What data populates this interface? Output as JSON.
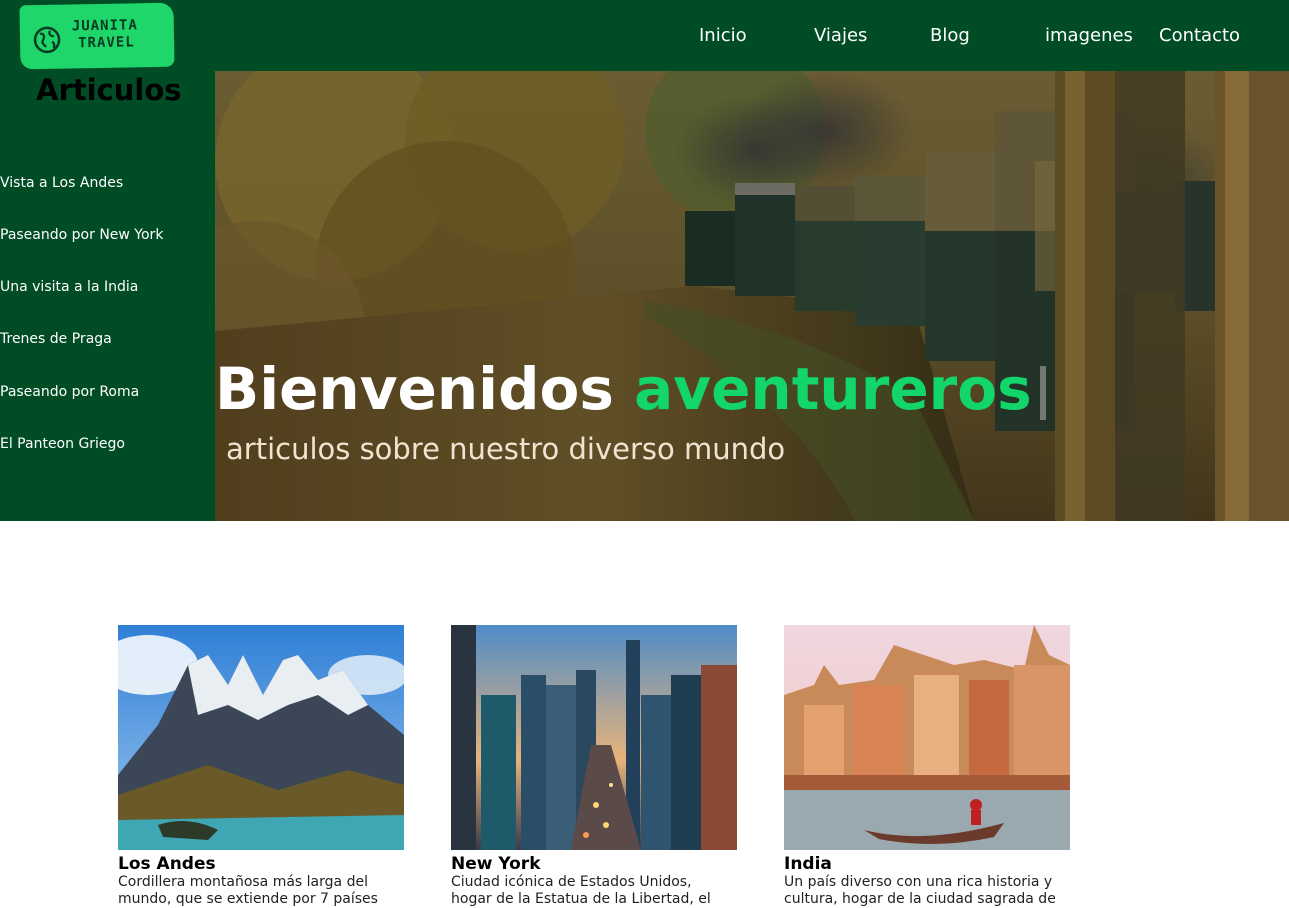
{
  "brand": {
    "logo_line1": "JUANITA",
    "logo_line2": "TRAVEL",
    "logo_color": "#1ed66a",
    "icon": "globe-icon"
  },
  "nav": {
    "items": [
      "Inicio",
      "Viajes",
      "Blog",
      "imagenes",
      "Contacto"
    ]
  },
  "sidebar": {
    "title": "Articulos",
    "items": [
      "Vista a Los Andes",
      "Paseando por New York",
      "Una visita a la India",
      "Trenes de Praga",
      "Paseando por Roma",
      "El Panteon Griego"
    ]
  },
  "hero": {
    "title_part1": "Bienvenidos",
    "title_part2": "aventureros",
    "subtitle": "articulos sobre nuestro diverso mundo",
    "accent_color": "#13d66b"
  },
  "cards": [
    {
      "title": "Los Andes",
      "desc_line1": "Cordillera montañosa más larga del",
      "desc_line2": "mundo, que se extiende por 7 países"
    },
    {
      "title": "New York",
      "desc_line1": "Ciudad icónica de Estados Unidos,",
      "desc_line2": "hogar de la Estatua de la Libertad, el"
    },
    {
      "title": "India",
      "desc_line1": "Un país diverso con una rica historia y",
      "desc_line2": "cultura, hogar de la ciudad sagrada de"
    }
  ],
  "colors": {
    "primary": "#004d25",
    "white": "#ffffff"
  }
}
